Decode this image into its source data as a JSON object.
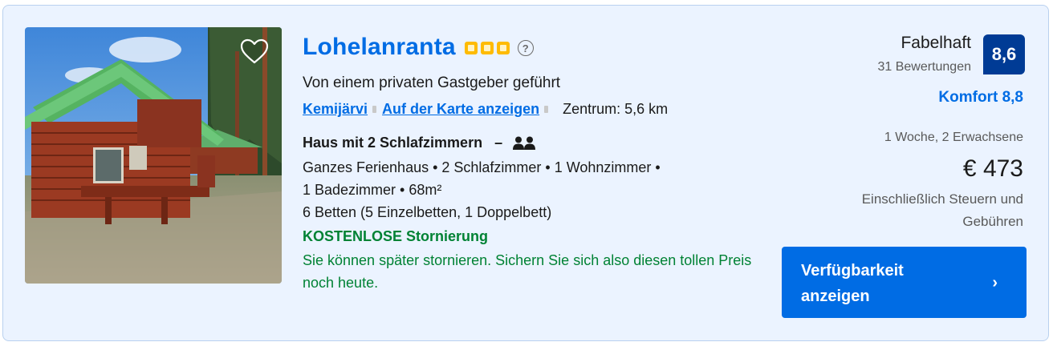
{
  "listing": {
    "name": "Lohelanranta",
    "star_rating": 3,
    "info_symbol": "?",
    "host_note": "Von einem privaten Gastgeber geführt",
    "location": {
      "city": "Kemijärvi",
      "map_link": "Auf der Karte anzeigen",
      "distance": "Zentrum: 5,6 km"
    },
    "room": {
      "title": "Haus mit 2 Schlafzimmern",
      "dash": "–",
      "occupancy_icon": "two-persons-icon",
      "details_line1": "Ganzes Ferienhaus • 2 Schlafzimmer • 1 Wohnzimmer •",
      "details_line2": "1 Badezimmer • 68m²",
      "beds": "6 Betten (5 Einzelbetten, 1 Doppelbett)"
    },
    "cancellation": {
      "title": "KOSTENLOSE Stornierung",
      "description": "Sie können später stornieren. Sichern Sie sich also diesen tollen Preis noch heute."
    }
  },
  "review": {
    "word": "Fabelhaft",
    "count": "31 Bewertungen",
    "score": "8,6",
    "comfort": "Komfort 8,8"
  },
  "pricing": {
    "stay": "1 Woche, 2 Erwachsene",
    "price": "€ 473",
    "taxes": "Einschließlich Steuern und Gebühren"
  },
  "cta": {
    "label": "Verfügbarkeit anzeigen",
    "chevron": "›"
  },
  "colors": {
    "brand_blue": "#006ce4",
    "score_blue": "#003b95",
    "green": "#008234",
    "star_yellow": "#febb02",
    "card_bg": "#ebf3ff"
  },
  "icons": {
    "favorite": "heart-icon",
    "info": "info-icon",
    "chevron": "chevron-right-icon"
  }
}
